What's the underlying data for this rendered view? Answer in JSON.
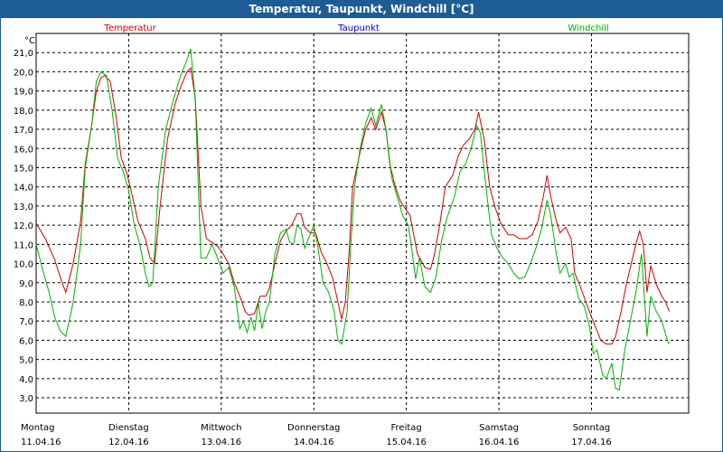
{
  "window": {
    "title": "Temperatur, Taupunkt, Windchill [°C]"
  },
  "colors": {
    "titlebar": "#1d5c94",
    "temperatur": "#d00000",
    "taupunkt": "#0000c0",
    "windchill": "#00b400"
  },
  "chart_data": {
    "type": "line",
    "title": "Temperatur, Taupunkt, Windchill [°C]",
    "ylabel": "°C",
    "ylim": [
      2.2,
      22.0
    ],
    "yticks": [
      "3,0",
      "4,0",
      "5,0",
      "6,0",
      "7,0",
      "8,0",
      "9,0",
      "10,0",
      "11,0",
      "12,0",
      "13,0",
      "14,0",
      "15,0",
      "16,0",
      "17,0",
      "18,0",
      "19,0",
      "20,0",
      "21,0"
    ],
    "grid": true,
    "legend": [
      {
        "name": "Temperatur",
        "color": "#d00000"
      },
      {
        "name": "Taupunkt",
        "color": "#0000c0"
      },
      {
        "name": "Windchill",
        "color": "#00b400"
      }
    ],
    "x_labels": [
      {
        "day": "Montag",
        "date": "11.04.16"
      },
      {
        "day": "Dienstag",
        "date": "12.04.16"
      },
      {
        "day": "Mittwoch",
        "date": "13.04.16"
      },
      {
        "day": "Donnerstag",
        "date": "14.04.16"
      },
      {
        "day": "Freitag",
        "date": "15.04.16"
      },
      {
        "day": "Samstag",
        "date": "16.04.16"
      },
      {
        "day": "Sonntag",
        "date": "17.04.16"
      }
    ],
    "x_unit": "days from 11.04.16 00:00",
    "xlim": [
      0,
      7.05
    ],
    "series": [
      {
        "name": "Temperatur",
        "color": "#d00000",
        "points": [
          [
            0.0,
            12.1
          ],
          [
            0.1,
            11.3
          ],
          [
            0.2,
            10.2
          ],
          [
            0.28,
            9.0
          ],
          [
            0.32,
            8.5
          ],
          [
            0.4,
            10.0
          ],
          [
            0.48,
            12.2
          ],
          [
            0.53,
            15.2
          ],
          [
            0.6,
            17.2
          ],
          [
            0.65,
            19.0
          ],
          [
            0.7,
            19.7
          ],
          [
            0.74,
            19.8
          ],
          [
            0.8,
            19.5
          ],
          [
            0.86,
            17.8
          ],
          [
            0.92,
            15.5
          ],
          [
            0.98,
            14.7
          ],
          [
            1.04,
            13.5
          ],
          [
            1.1,
            12.2
          ],
          [
            1.18,
            11.3
          ],
          [
            1.23,
            10.3
          ],
          [
            1.28,
            10.0
          ],
          [
            1.34,
            13.0
          ],
          [
            1.42,
            16.5
          ],
          [
            1.5,
            18.3
          ],
          [
            1.56,
            19.2
          ],
          [
            1.63,
            20.0
          ],
          [
            1.67,
            20.2
          ],
          [
            1.72,
            18.6
          ],
          [
            1.78,
            13.0
          ],
          [
            1.84,
            11.3
          ],
          [
            1.9,
            11.1
          ],
          [
            1.96,
            10.9
          ],
          [
            2.02,
            10.5
          ],
          [
            2.08,
            10.0
          ],
          [
            2.14,
            9.0
          ],
          [
            2.2,
            8.3
          ],
          [
            2.26,
            7.5
          ],
          [
            2.3,
            7.3
          ],
          [
            2.36,
            7.4
          ],
          [
            2.42,
            8.3
          ],
          [
            2.48,
            8.3
          ],
          [
            2.52,
            8.7
          ],
          [
            2.58,
            10.0
          ],
          [
            2.64,
            11.2
          ],
          [
            2.7,
            11.7
          ],
          [
            2.76,
            12.0
          ],
          [
            2.82,
            12.6
          ],
          [
            2.86,
            12.6
          ],
          [
            2.9,
            11.9
          ],
          [
            2.96,
            11.6
          ],
          [
            3.02,
            11.6
          ],
          [
            3.08,
            10.6
          ],
          [
            3.14,
            10.0
          ],
          [
            3.2,
            9.3
          ],
          [
            3.26,
            8.0
          ],
          [
            3.3,
            7.1
          ],
          [
            3.34,
            8.0
          ],
          [
            3.38,
            10.5
          ],
          [
            3.42,
            14.0
          ],
          [
            3.5,
            15.8
          ],
          [
            3.56,
            17.0
          ],
          [
            3.62,
            17.6
          ],
          [
            3.67,
            17.0
          ],
          [
            3.73,
            17.9
          ],
          [
            3.78,
            17.0
          ],
          [
            3.82,
            15.2
          ],
          [
            3.88,
            14.0
          ],
          [
            3.94,
            13.2
          ],
          [
            4.0,
            12.8
          ],
          [
            4.04,
            12.5
          ],
          [
            4.08,
            11.5
          ],
          [
            4.12,
            10.5
          ],
          [
            4.2,
            9.8
          ],
          [
            4.26,
            9.7
          ],
          [
            4.3,
            10.4
          ],
          [
            4.36,
            12.0
          ],
          [
            4.42,
            14.0
          ],
          [
            4.5,
            14.6
          ],
          [
            4.56,
            15.6
          ],
          [
            4.62,
            16.2
          ],
          [
            4.68,
            16.5
          ],
          [
            4.74,
            17.0
          ],
          [
            4.78,
            17.9
          ],
          [
            4.84,
            16.5
          ],
          [
            4.9,
            14.0
          ],
          [
            4.96,
            12.9
          ],
          [
            5.02,
            12.1
          ],
          [
            5.1,
            11.5
          ],
          [
            5.16,
            11.5
          ],
          [
            5.22,
            11.3
          ],
          [
            5.3,
            11.3
          ],
          [
            5.36,
            11.5
          ],
          [
            5.42,
            12.2
          ],
          [
            5.48,
            13.5
          ],
          [
            5.52,
            14.6
          ],
          [
            5.56,
            13.5
          ],
          [
            5.62,
            12.2
          ],
          [
            5.66,
            11.6
          ],
          [
            5.72,
            11.9
          ],
          [
            5.78,
            11.3
          ],
          [
            5.82,
            9.5
          ],
          [
            5.88,
            8.8
          ],
          [
            5.94,
            8.0
          ],
          [
            6.0,
            7.2
          ],
          [
            6.06,
            6.5
          ],
          [
            6.1,
            6.0
          ],
          [
            6.16,
            5.8
          ],
          [
            6.22,
            5.8
          ],
          [
            6.26,
            6.2
          ],
          [
            6.32,
            7.5
          ],
          [
            6.38,
            9.0
          ],
          [
            6.44,
            10.2
          ],
          [
            6.48,
            11.0
          ],
          [
            6.52,
            11.7
          ],
          [
            6.56,
            11.0
          ],
          [
            6.6,
            8.5
          ],
          [
            6.64,
            9.9
          ],
          [
            6.7,
            8.9
          ],
          [
            6.76,
            8.3
          ],
          [
            6.8,
            8.0
          ],
          [
            6.84,
            7.5
          ]
        ]
      },
      {
        "name": "Windchill",
        "color": "#00b400",
        "points": [
          [
            0.0,
            11.0
          ],
          [
            0.08,
            9.5
          ],
          [
            0.14,
            8.5
          ],
          [
            0.2,
            7.2
          ],
          [
            0.26,
            6.5
          ],
          [
            0.32,
            6.2
          ],
          [
            0.4,
            8.0
          ],
          [
            0.48,
            11.0
          ],
          [
            0.53,
            15.0
          ],
          [
            0.6,
            17.2
          ],
          [
            0.65,
            19.5
          ],
          [
            0.7,
            20.0
          ],
          [
            0.76,
            19.8
          ],
          [
            0.82,
            18.0
          ],
          [
            0.88,
            15.5
          ],
          [
            0.94,
            14.8
          ],
          [
            1.0,
            13.8
          ],
          [
            1.06,
            12.0
          ],
          [
            1.12,
            11.0
          ],
          [
            1.18,
            9.5
          ],
          [
            1.22,
            8.8
          ],
          [
            1.26,
            9.0
          ],
          [
            1.32,
            14.0
          ],
          [
            1.4,
            17.0
          ],
          [
            1.48,
            18.5
          ],
          [
            1.56,
            19.8
          ],
          [
            1.62,
            20.5
          ],
          [
            1.67,
            21.2
          ],
          [
            1.72,
            18.5
          ],
          [
            1.78,
            10.3
          ],
          [
            1.84,
            10.3
          ],
          [
            1.9,
            11.0
          ],
          [
            1.96,
            10.3
          ],
          [
            2.02,
            9.5
          ],
          [
            2.08,
            9.8
          ],
          [
            2.14,
            8.8
          ],
          [
            2.2,
            6.6
          ],
          [
            2.24,
            7.0
          ],
          [
            2.28,
            6.4
          ],
          [
            2.32,
            7.2
          ],
          [
            2.36,
            6.5
          ],
          [
            2.4,
            8.0
          ],
          [
            2.44,
            6.6
          ],
          [
            2.48,
            7.5
          ],
          [
            2.52,
            8.0
          ],
          [
            2.58,
            10.5
          ],
          [
            2.64,
            11.6
          ],
          [
            2.7,
            11.8
          ],
          [
            2.74,
            11.1
          ],
          [
            2.78,
            11.0
          ],
          [
            2.82,
            12.0
          ],
          [
            2.86,
            11.8
          ],
          [
            2.9,
            10.8
          ],
          [
            2.96,
            11.5
          ],
          [
            3.0,
            12.0
          ],
          [
            3.04,
            11.0
          ],
          [
            3.1,
            9.0
          ],
          [
            3.16,
            8.5
          ],
          [
            3.22,
            7.5
          ],
          [
            3.26,
            6.0
          ],
          [
            3.3,
            5.8
          ],
          [
            3.36,
            7.5
          ],
          [
            3.4,
            11.0
          ],
          [
            3.44,
            14.0
          ],
          [
            3.5,
            16.0
          ],
          [
            3.56,
            17.3
          ],
          [
            3.62,
            18.1
          ],
          [
            3.67,
            17.2
          ],
          [
            3.73,
            18.3
          ],
          [
            3.78,
            17.0
          ],
          [
            3.84,
            14.5
          ],
          [
            3.9,
            13.5
          ],
          [
            3.96,
            12.5
          ],
          [
            4.02,
            12.0
          ],
          [
            4.06,
            10.7
          ],
          [
            4.1,
            9.2
          ],
          [
            4.14,
            10.3
          ],
          [
            4.2,
            8.8
          ],
          [
            4.26,
            8.5
          ],
          [
            4.32,
            9.3
          ],
          [
            4.38,
            11.2
          ],
          [
            4.44,
            12.4
          ],
          [
            4.52,
            13.5
          ],
          [
            4.58,
            14.8
          ],
          [
            4.64,
            15.2
          ],
          [
            4.7,
            16.0
          ],
          [
            4.76,
            17.2
          ],
          [
            4.8,
            16.8
          ],
          [
            4.86,
            14.0
          ],
          [
            4.92,
            11.5
          ],
          [
            4.98,
            10.8
          ],
          [
            5.04,
            10.3
          ],
          [
            5.1,
            10.0
          ],
          [
            5.16,
            9.5
          ],
          [
            5.22,
            9.2
          ],
          [
            5.28,
            9.3
          ],
          [
            5.34,
            10.0
          ],
          [
            5.4,
            10.8
          ],
          [
            5.46,
            11.8
          ],
          [
            5.52,
            13.3
          ],
          [
            5.56,
            12.5
          ],
          [
            5.62,
            10.5
          ],
          [
            5.66,
            9.5
          ],
          [
            5.72,
            10.0
          ],
          [
            5.76,
            9.3
          ],
          [
            5.8,
            9.5
          ],
          [
            5.86,
            8.2
          ],
          [
            5.92,
            7.8
          ],
          [
            5.98,
            6.7
          ],
          [
            6.02,
            5.3
          ],
          [
            6.06,
            5.5
          ],
          [
            6.12,
            4.2
          ],
          [
            6.16,
            4.0
          ],
          [
            6.22,
            4.8
          ],
          [
            6.26,
            3.5
          ],
          [
            6.3,
            3.4
          ],
          [
            6.36,
            5.5
          ],
          [
            6.42,
            7.0
          ],
          [
            6.48,
            8.5
          ],
          [
            6.54,
            10.5
          ],
          [
            6.6,
            6.2
          ],
          [
            6.64,
            8.3
          ],
          [
            6.7,
            7.5
          ],
          [
            6.76,
            7.0
          ],
          [
            6.82,
            6.0
          ],
          [
            6.84,
            5.8
          ]
        ]
      }
    ]
  }
}
